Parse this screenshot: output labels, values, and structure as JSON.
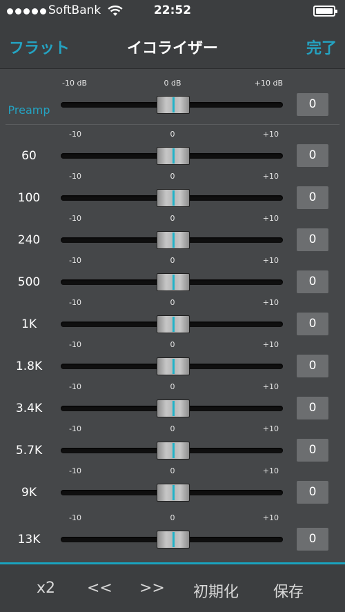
{
  "status": {
    "carrier": "SoftBank",
    "time": "22:52"
  },
  "nav": {
    "left": "フラット",
    "title": "イコライザー",
    "right": "完了"
  },
  "preamp": {
    "label": "Preamp",
    "min": "-10 dB",
    "mid": "0 dB",
    "max": "+10 dB",
    "value": "0"
  },
  "bands": [
    {
      "label": "60",
      "min": "-10",
      "mid": "0",
      "max": "+10",
      "value": "0"
    },
    {
      "label": "100",
      "min": "-10",
      "mid": "0",
      "max": "+10",
      "value": "0"
    },
    {
      "label": "240",
      "min": "-10",
      "mid": "0",
      "max": "+10",
      "value": "0"
    },
    {
      "label": "500",
      "min": "-10",
      "mid": "0",
      "max": "+10",
      "value": "0"
    },
    {
      "label": "1K",
      "min": "-10",
      "mid": "0",
      "max": "+10",
      "value": "0"
    },
    {
      "label": "1.8K",
      "min": "-10",
      "mid": "0",
      "max": "+10",
      "value": "0"
    },
    {
      "label": "3.4K",
      "min": "-10",
      "mid": "0",
      "max": "+10",
      "value": "0"
    },
    {
      "label": "5.7K",
      "min": "-10",
      "mid": "0",
      "max": "+10",
      "value": "0"
    },
    {
      "label": "9K",
      "min": "-10",
      "mid": "0",
      "max": "+10",
      "value": "0"
    },
    {
      "label": "13K",
      "min": "-10",
      "mid": "0",
      "max": "+10",
      "value": "0"
    }
  ],
  "toolbar": {
    "x2": "x2",
    "prev": "<<",
    "next": ">>",
    "reset": "初期化",
    "save": "保存"
  },
  "colors": {
    "accent": "#24a3c2",
    "background": "#454749",
    "bar": "#3c3e40"
  },
  "icons": {
    "signal": "signal-dots-icon",
    "wifi": "wifi-icon",
    "battery": "battery-icon"
  }
}
